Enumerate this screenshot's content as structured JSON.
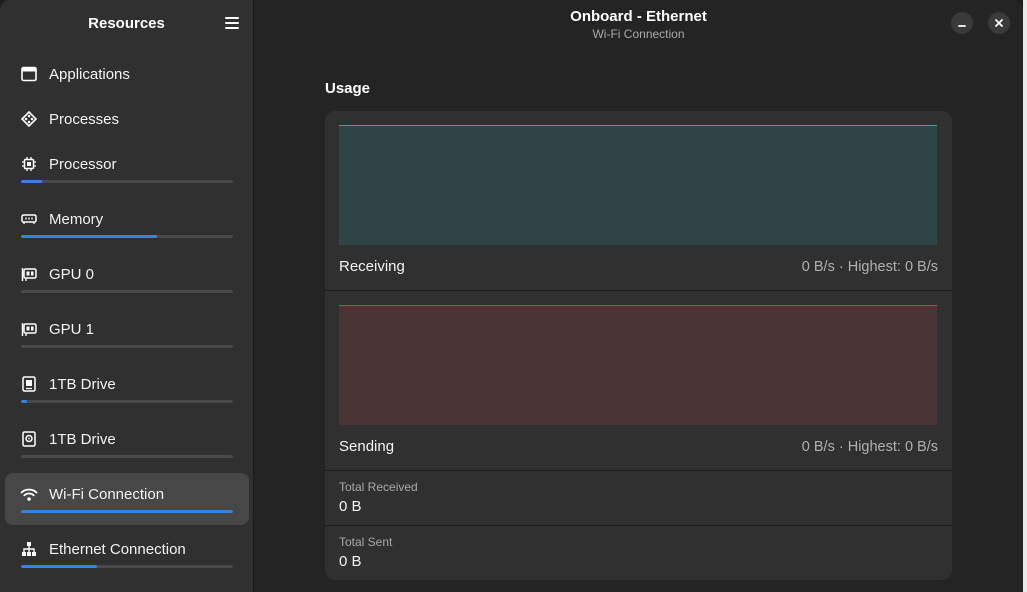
{
  "sidebar": {
    "title": "Resources",
    "items": [
      {
        "label": "Applications",
        "icon": "window-icon"
      },
      {
        "label": "Processes",
        "icon": "processes-icon"
      },
      {
        "label": "Processor",
        "icon": "cpu-icon",
        "usage_fraction": 0.1
      },
      {
        "label": "Memory",
        "icon": "memory-icon",
        "usage_fraction": 0.64
      },
      {
        "label": "GPU 0",
        "icon": "gpu-icon",
        "usage_fraction": 0.0
      },
      {
        "label": "GPU 1",
        "icon": "gpu-icon",
        "usage_fraction": 0.0
      },
      {
        "label": "1TB Drive",
        "icon": "drive-icon",
        "usage_fraction": 0.03
      },
      {
        "label": "1TB Drive",
        "icon": "drive-icon",
        "usage_fraction": 0.0
      },
      {
        "label": "Wi-Fi Connection",
        "icon": "wifi-icon",
        "usage_fraction": 1.0,
        "active": true
      },
      {
        "label": "Ethernet Connection",
        "icon": "ethernet-icon",
        "usage_fraction": 0.36
      }
    ]
  },
  "header": {
    "title": "Onboard - Ethernet",
    "subtitle": "Wi-Fi Connection"
  },
  "main": {
    "section_title": "Usage",
    "receiving": {
      "label": "Receiving",
      "value": "0 B/s · Highest: 0 B/s"
    },
    "sending": {
      "label": "Sending",
      "value": "0 B/s · Highest: 0 B/s"
    },
    "total_received": {
      "label": "Total Received",
      "value": "0 B"
    },
    "total_sent": {
      "label": "Total Sent",
      "value": "0 B"
    }
  },
  "colors": {
    "accent": "#3584e4",
    "receiving_fill": "#2f4444",
    "receiving_line": "#4a9d9d",
    "sending_fill": "#4a3536",
    "sending_line": "#a84a4e"
  }
}
